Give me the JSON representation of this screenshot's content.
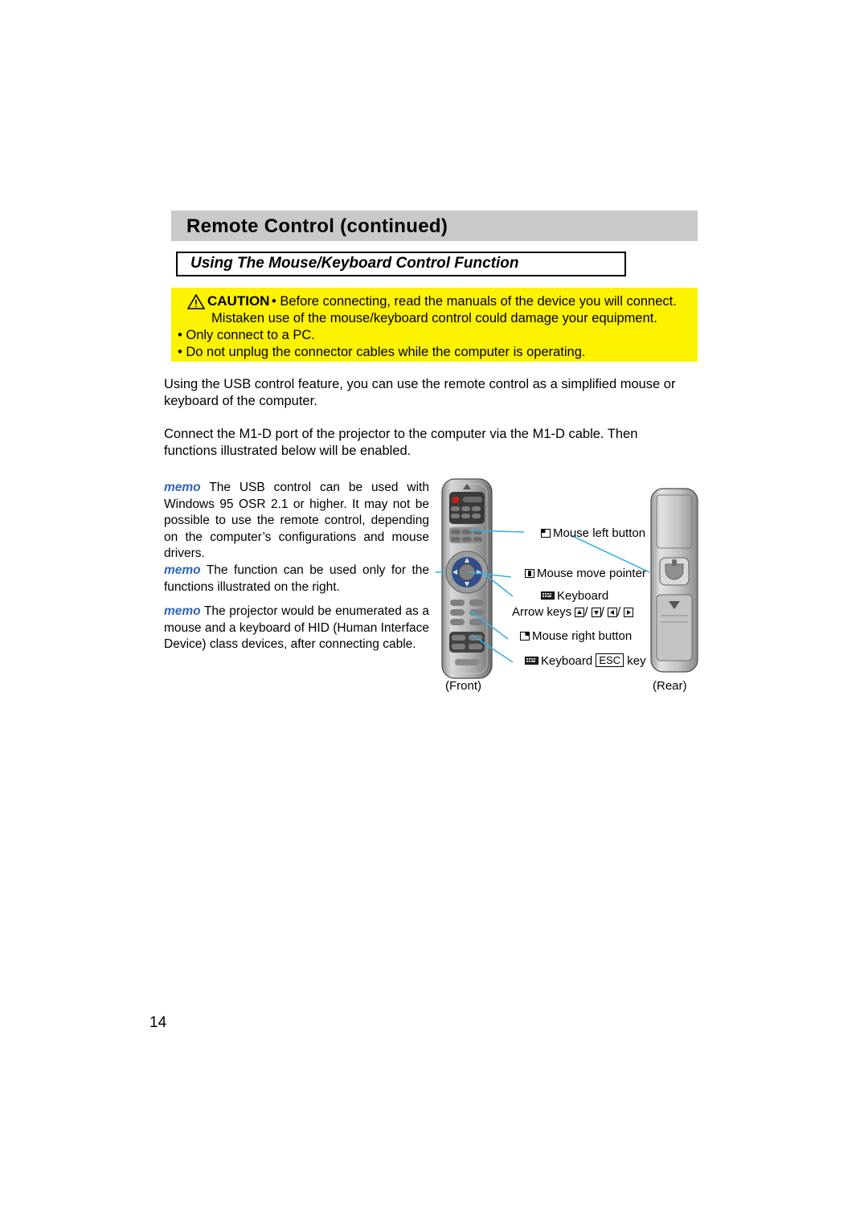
{
  "header": {
    "title": "Remote Control (continued)"
  },
  "subheading": {
    "text": "Using The Mouse/Keyboard Control Function"
  },
  "caution": {
    "label": "CAUTION",
    "line1": "• Before connecting, read the manuals of the device you will connect.",
    "line2": "Mistaken use of the mouse/keyboard control could damage your equipment.",
    "bullet1": "• Only connect to a PC.",
    "bullet2": "• Do not unplug the connector cables while the computer is operating."
  },
  "body": {
    "para_usb": "Using the USB control feature, you can use the remote control as a simplified mouse or keyboard of the computer.",
    "para_m1d": "Connect the M1-D port of the projector to the computer via the M1-D cable. Then functions illustrated below will be enabled."
  },
  "memos": {
    "label": "memo",
    "memo1": "The USB control can be used with Windows 95 OSR 2.1 or higher. It may not be possible to use the remote control, depending on the computer’s configurations and mouse drivers.",
    "memo2": "The function can be used only for the functions illustrated on the right.",
    "memo3": "The projector would be enumerated as a mouse and a keyboard of HID (Human Interface Device) class devices, after connecting cable."
  },
  "callouts": {
    "mouse_left": "Mouse left button",
    "mouse_move": "Mouse move pointer",
    "keyboard": "Keyboard",
    "arrow_keys": "Arrow keys",
    "arrow_sep": "/",
    "mouse_right": "Mouse right button",
    "keyboard_esc_prefix": "Keyboard",
    "esc_label": "ESC",
    "keyboard_esc_suffix": "key",
    "front": "(Front)",
    "rear": "(Rear)"
  },
  "page_number": "14",
  "colors": {
    "header_bar": "#c9c9c9",
    "caution_bg": "#fdf200",
    "memo_label": "#2b66bb",
    "callout_line": "#35b4e8"
  }
}
